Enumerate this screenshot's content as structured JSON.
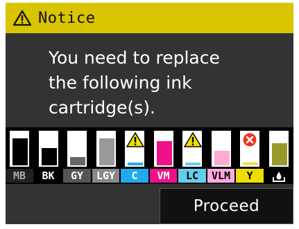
{
  "header": {
    "title": "Notice",
    "icon": "warning-triangle-icon",
    "background": "#d8c400"
  },
  "message": {
    "lines": [
      "You need to replace",
      "the following ink",
      "cartridge(s)."
    ]
  },
  "cartridges": [
    {
      "label": "MB",
      "status": "ok",
      "label_bg": "#222222",
      "label_fg": "#aaaaaa",
      "fill_color": "#000000",
      "level": 0.85
    },
    {
      "label": "BK",
      "status": "ok",
      "label_bg": "#000000",
      "label_fg": "#ffffff",
      "fill_color": "#000000",
      "level": 0.55
    },
    {
      "label": "GY",
      "status": "ok",
      "label_bg": "#555555",
      "label_fg": "#ffffff",
      "fill_color": "#666666",
      "level": 0.25
    },
    {
      "label": "LGY",
      "status": "ok",
      "label_bg": "#888888",
      "label_fg": "#ffffff",
      "fill_color": "#999999",
      "level": 0.85
    },
    {
      "label": "C",
      "status": "low",
      "label_bg": "#22aaee",
      "label_fg": "#ffffff",
      "fill_color": "#22aaee",
      "level": 0.08
    },
    {
      "label": "VM",
      "status": "ok",
      "label_bg": "#ee1188",
      "label_fg": "#ffffff",
      "fill_color": "#ee1188",
      "level": 0.75
    },
    {
      "label": "LC",
      "status": "low",
      "label_bg": "#66ccee",
      "label_fg": "#000000",
      "fill_color": "#66ccee",
      "level": 0.06
    },
    {
      "label": "VLM",
      "status": "ok",
      "label_bg": "#ffaadd",
      "label_fg": "#000000",
      "fill_color": "#ffaad0",
      "level": 0.45
    },
    {
      "label": "Y",
      "status": "replace",
      "label_bg": "#eedd00",
      "label_fg": "#000000",
      "fill_color": "#eedd00",
      "level": 0.0
    },
    {
      "label": "",
      "status": "ok",
      "label_bg": "#000000",
      "label_fg": "#ffffff",
      "fill_color": "#99992a",
      "level": 0.7,
      "icon": "ink-drop-icon"
    }
  ],
  "proceed_button": {
    "label": "Proceed"
  }
}
